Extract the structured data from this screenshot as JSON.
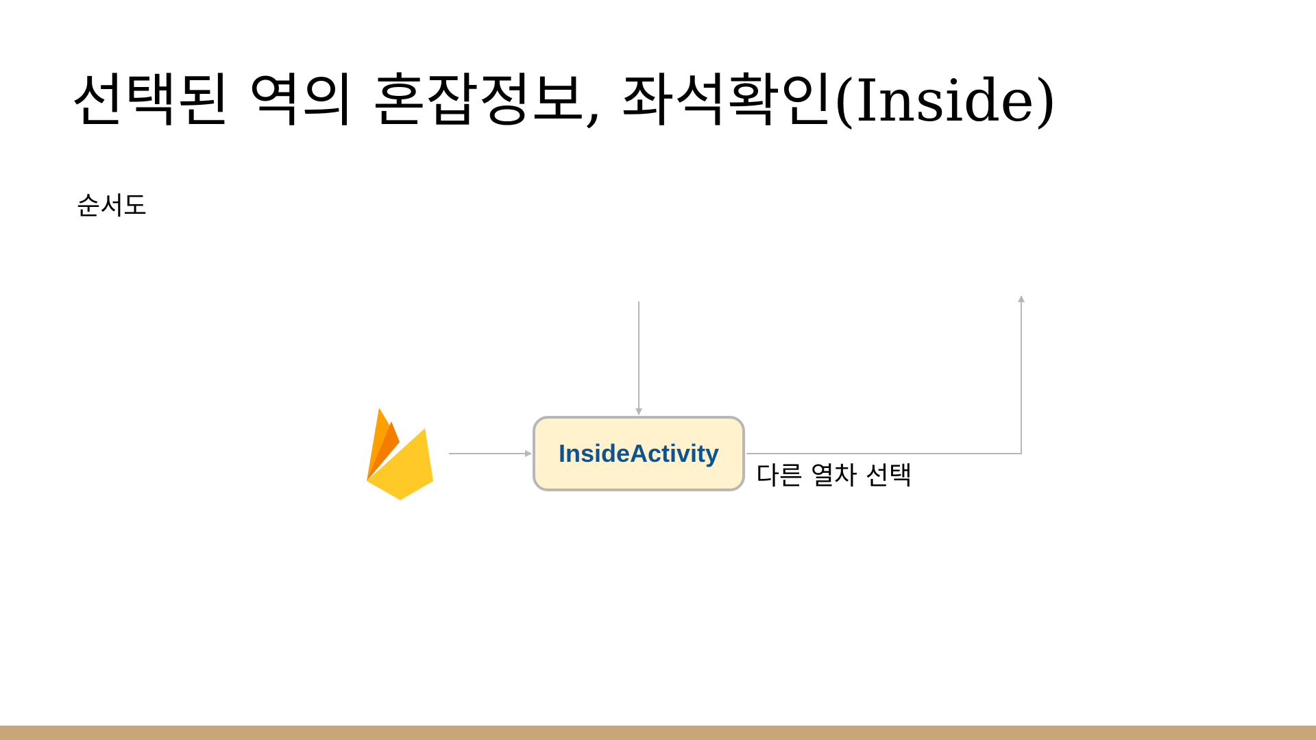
{
  "slide": {
    "title": "선택된 역의 혼잡정보, 좌석확인(Inside)",
    "subtitle": "순서도"
  },
  "diagram": {
    "source_icon": "firebase-icon",
    "activity_label": "InsideActivity",
    "edge_label": "다른 열차 선택"
  },
  "colors": {
    "box_fill": "#fff2cc",
    "box_border": "#b7b7b7",
    "box_text": "#0b5394",
    "arrow": "#b7b7b7",
    "footer": "#c8a67a",
    "flame_yellow": "#ffca28",
    "flame_orange": "#ffa000",
    "flame_dark": "#f57c00"
  }
}
